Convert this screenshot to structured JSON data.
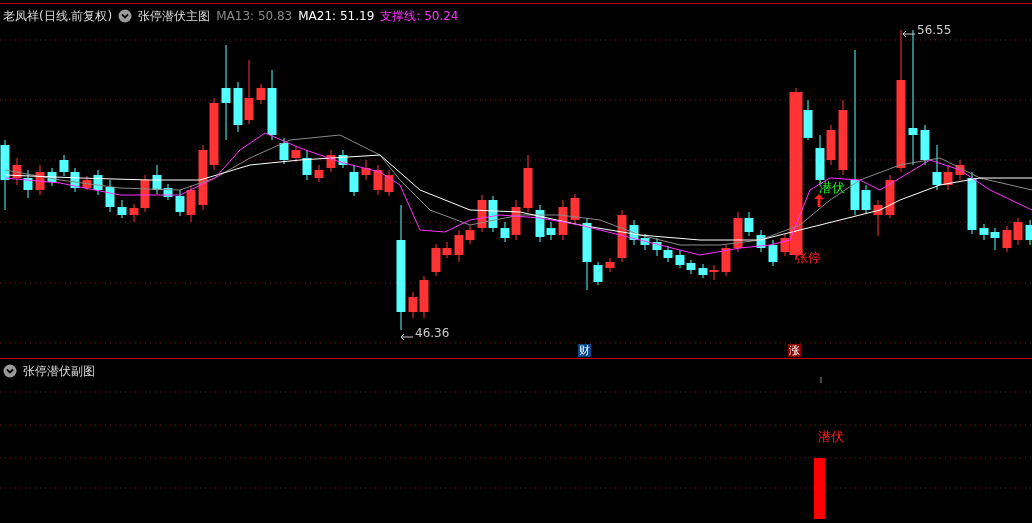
{
  "main_panel": {
    "stock_title": "老凤祥(日线.前复权)",
    "indicator": "张停潜伏主图",
    "indicator_values": [
      {
        "label": "MA13: 50.83",
        "color": "#8a8a8a"
      },
      {
        "label": "MA21: 51.19",
        "color": "#ffffff"
      },
      {
        "label": "支撑线: 50.24",
        "color": "#ff33ff"
      }
    ],
    "price_labels": [
      {
        "kind": "high",
        "text": "56.55"
      },
      {
        "kind": "low",
        "text": "46.36"
      }
    ],
    "signals": [
      {
        "kind": "buy",
        "text": "潜伏"
      },
      {
        "kind": "limit_up",
        "text": "张停"
      }
    ],
    "event_badges": [
      {
        "kind": "finance",
        "text": "财"
      },
      {
        "kind": "limit_up",
        "text": "涨"
      }
    ]
  },
  "sub_panel": {
    "indicator": "张停潜伏副图",
    "signal_label": "潜伏"
  }
}
